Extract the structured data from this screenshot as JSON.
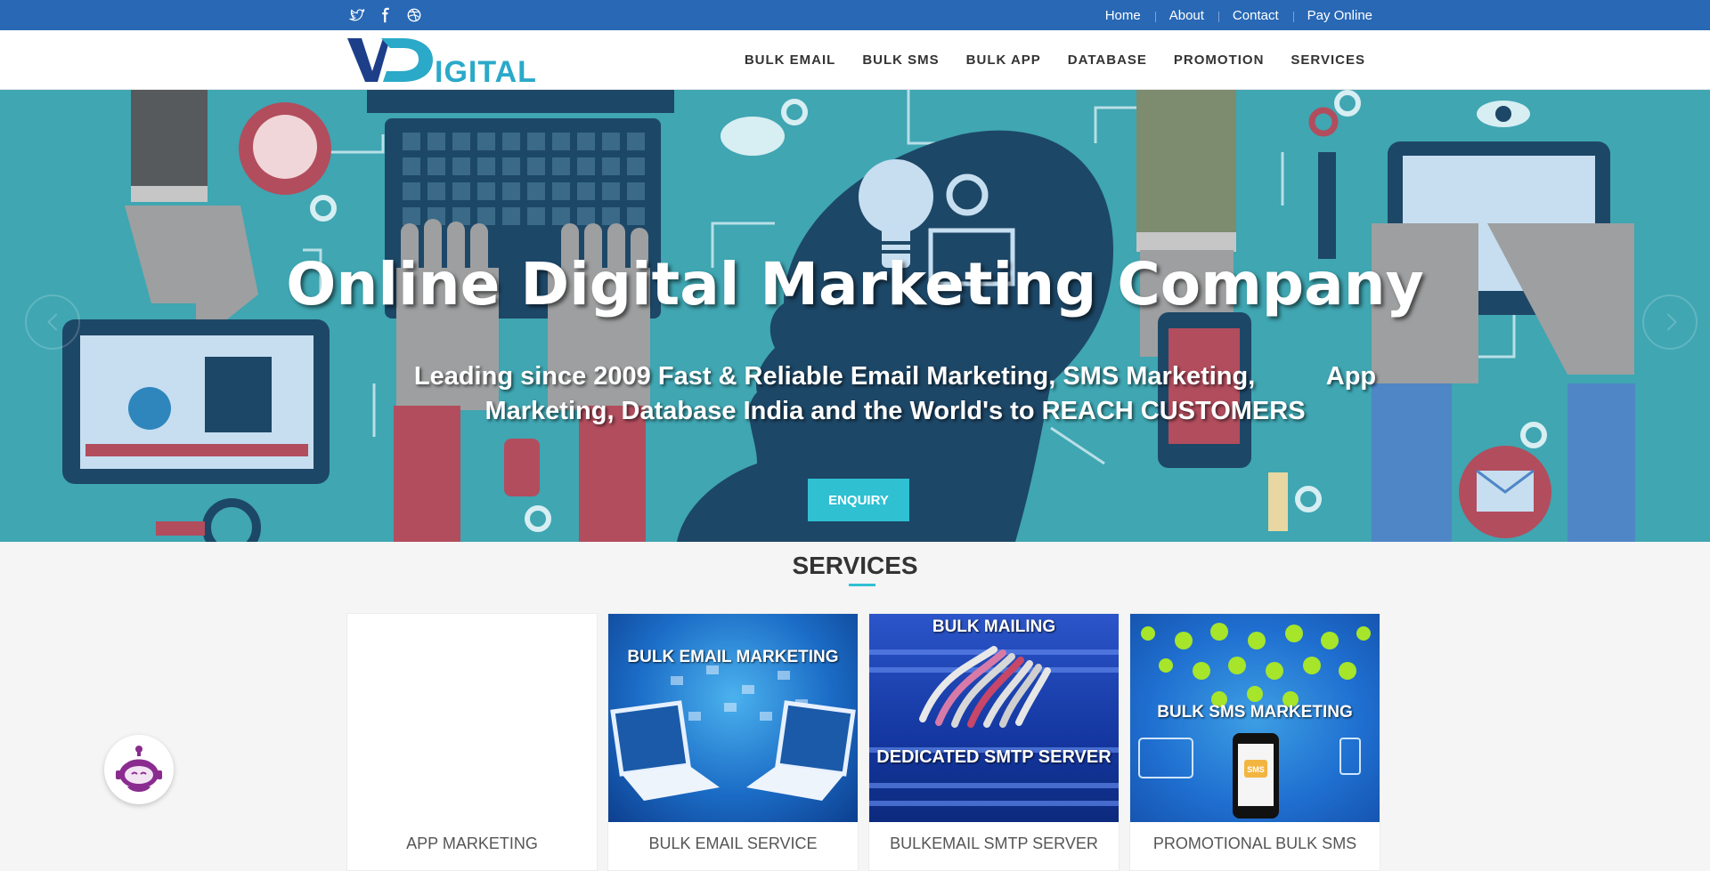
{
  "topbar": {
    "social_icons": [
      "twitter-icon",
      "facebook-icon",
      "dribbble-icon"
    ],
    "links": [
      "Home",
      "About",
      "Contact",
      "Pay Online"
    ]
  },
  "header": {
    "logo_text": "VDIGITAL",
    "nav": [
      "BULK EMAIL",
      "BULK SMS",
      "BULK APP",
      "DATABASE",
      "PROMOTION",
      "SERVICES"
    ]
  },
  "hero": {
    "title": "Online Digital Marketing Company",
    "subtitle_line1": "Leading since 2009 Fast & Reliable Email Marketing, SMS Marketing,          App",
    "subtitle_line2": "Marketing, Database India and the World's to REACH CUSTOMERS",
    "button": "ENQUIRY"
  },
  "services": {
    "title": "SERVICES",
    "cards": [
      {
        "label": "APP MARKETING",
        "image_caption": "",
        "image_caption2": ""
      },
      {
        "label": "BULK EMAIL SERVICE",
        "image_caption": "BULK EMAIL MARKETING",
        "image_caption2": ""
      },
      {
        "label": "BULKEMAIL SMTP SERVER",
        "image_caption": "BULK MAILING",
        "image_caption2": "DEDICATED SMTP SERVER"
      },
      {
        "label": "PROMOTIONAL BULK SMS",
        "image_caption": "BULK SMS MARKETING",
        "image_caption2": "SMS"
      }
    ]
  },
  "colors": {
    "topbar": "#2868b5",
    "hero_bg": "#3fa6b2",
    "accent": "#2fc0d2",
    "logo_dark": "#1d3f8a",
    "logo_light": "#2aa9c9"
  }
}
